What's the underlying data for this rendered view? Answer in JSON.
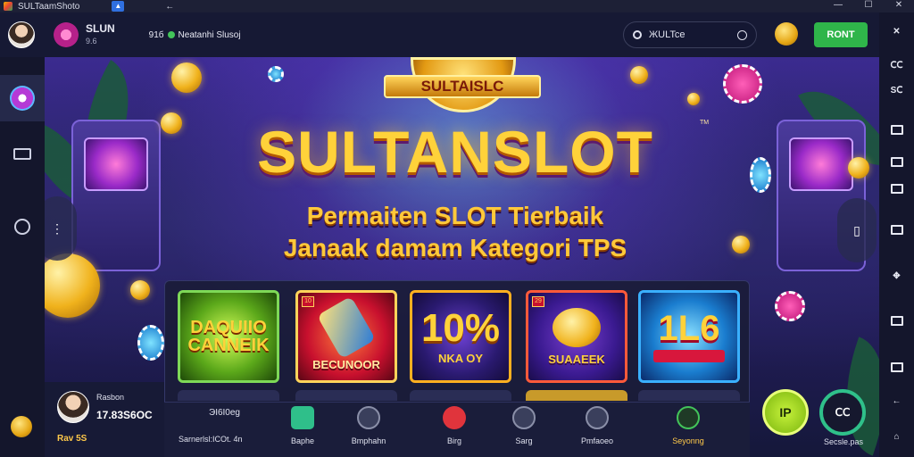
{
  "titlebar": {
    "app_name": "SULTaamShoto",
    "win_controls": [
      "—",
      "☐",
      "✕"
    ]
  },
  "header": {
    "user_name": "SLUN",
    "user_sub": "9.6",
    "count_text": "91б",
    "count_label": "Neatanhi Slusoj",
    "search_text": "ЖULTce",
    "rent_label": "RONT"
  },
  "right_sidebar": [
    "ⅭⅭ",
    "ⅭⅭ",
    "SⅭ",
    "",
    "",
    "",
    "",
    "",
    "",
    "",
    ""
  ],
  "banner": {
    "crest_text": "SULTAISLC",
    "title": "SULTANSLOT",
    "tm": "TM",
    "subtitle_1": "Permaiten SLOT Tierbaik",
    "subtitle_2": "Janaak damam Kategori TPS"
  },
  "games": [
    {
      "art": "DAQUIIO\nCANNEIK",
      "caption": "",
      "corner": ""
    },
    {
      "art": "",
      "caption": "BECUNOOR",
      "corner": "10"
    },
    {
      "art": "10%",
      "caption": "NKA OY",
      "corner": ""
    },
    {
      "art": "",
      "caption": "SUAAEEK",
      "corner": "29"
    },
    {
      "art": "1L6",
      "caption": "",
      "corner": ""
    }
  ],
  "player": {
    "name": "Rasbon",
    "number": "17.83S6OC",
    "level": "Rav 5S"
  },
  "bottom_bar": {
    "left_top": "ЭI6I0eg",
    "left_bottom": "Sarnerlsl:ICOt. 4n",
    "nav": [
      {
        "label": "Baphe",
        "color": "#2fbf8a"
      },
      {
        "label": "Bmphahn",
        "color": "#5a6078"
      },
      {
        "label": "Birg",
        "color": "#e0343c"
      },
      {
        "label": "Sarg",
        "color": "#5a6078"
      },
      {
        "label": "Pmfaoeo",
        "color": "#5a6078"
      },
      {
        "label": "Seyonng",
        "color": "#43c45a"
      }
    ]
  },
  "round_buttons": {
    "green_label": "IP",
    "dark_label": "ⅭⅭ",
    "dark_caption": "Secsle.pas"
  }
}
